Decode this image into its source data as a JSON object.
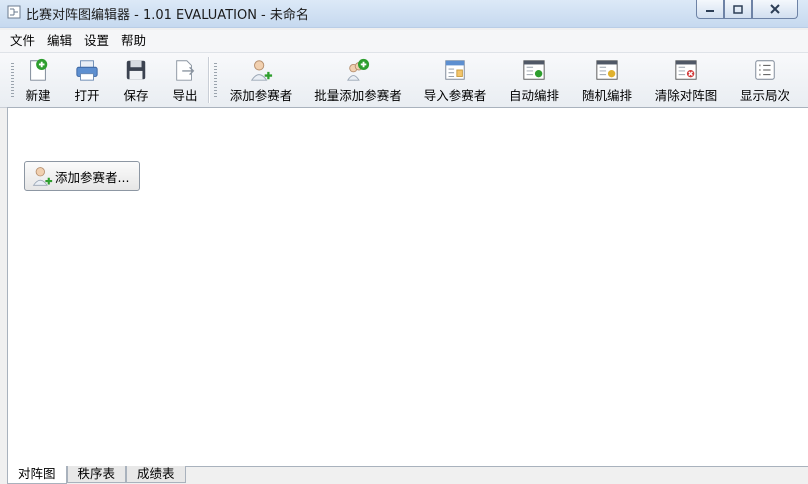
{
  "window": {
    "title": "比赛对阵图编辑器 - 1.01 EVALUATION - 未命名"
  },
  "menu": [
    "文件",
    "编辑",
    "设置",
    "帮助"
  ],
  "toolbar": {
    "new": "新建",
    "open": "打开",
    "save": "保存",
    "export": "导出",
    "add_participant": "添加参赛者",
    "batch_add": "批量添加参赛者",
    "import": "导入参赛者",
    "auto_arrange": "自动编排",
    "random_arrange": "随机编排",
    "clear_bracket": "清除对阵图",
    "show_rounds": "显示局次"
  },
  "content": {
    "add_button": "添加参赛者..."
  },
  "tabs": [
    "对阵图",
    "秩序表",
    "成绩表"
  ],
  "colors": {
    "accent_green": "#2e9e2e",
    "title_gradient": "#c6d9ef"
  }
}
